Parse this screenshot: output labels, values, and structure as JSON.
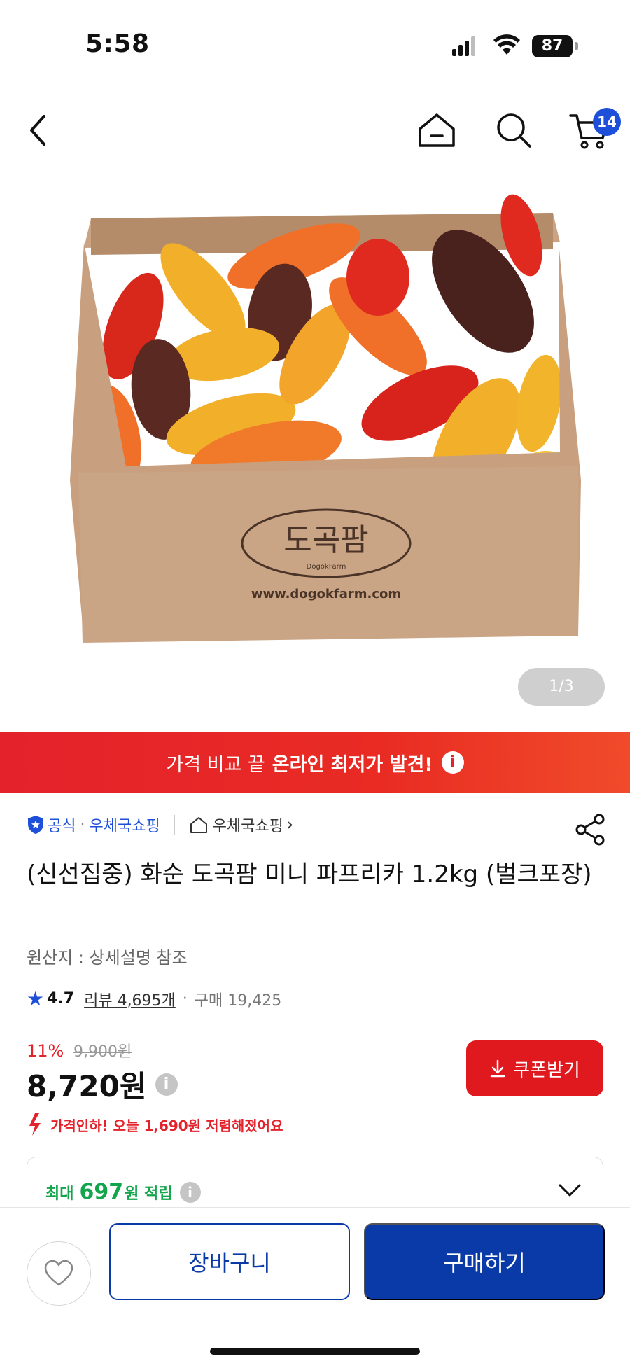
{
  "status_bar": {
    "time": "5:58",
    "battery": "87"
  },
  "top_nav": {
    "cart_count": "14",
    "icons": [
      "back-arrow-icon",
      "home-icon",
      "search-icon",
      "cart-icon"
    ]
  },
  "gallery": {
    "image_alt": "도곡팜 미니 파프리카 박스",
    "box_logo": "도곡팜",
    "box_logo_en": "DogokFarm",
    "box_url": "www.dogokfarm.com",
    "counter": "1/3"
  },
  "banner": {
    "text": "가격 비교 끝",
    "emphasis": "온라인 최저가 발견!",
    "info_icon": "i"
  },
  "seller": {
    "official": "공식",
    "separator": "·",
    "name": "우체국쇼핑",
    "store_link": "우체국쇼핑",
    "store_chevron": "›"
  },
  "product": {
    "title": "(신선집중) 화순 도곡팜 미니 파프리카 1.2kg (벌크포장)",
    "origin": "원산지 : 상세설명 참조",
    "rating": "4.7",
    "reviews": "리뷰 4,695개",
    "purchase_sep": "·",
    "purchases": "구매 19,425"
  },
  "price": {
    "discount_rate": "11%",
    "original": "9,900원",
    "sale": "8,720원",
    "info_icon": "i",
    "coupon_label": "쿠폰받기",
    "price_drop": "가격인하! 오늘 1,690원 저렴해졌어요"
  },
  "points": {
    "prefix": "최대",
    "amount": "697",
    "suffix": "원 적립",
    "info_icon": "i"
  },
  "bottom_bar": {
    "cart_label": "장바구니",
    "buy_label": "구매하기"
  },
  "colors": {
    "brand_blue": "#0a3aa8",
    "accent_red": "#e4222c",
    "points_green": "#13a54c"
  }
}
